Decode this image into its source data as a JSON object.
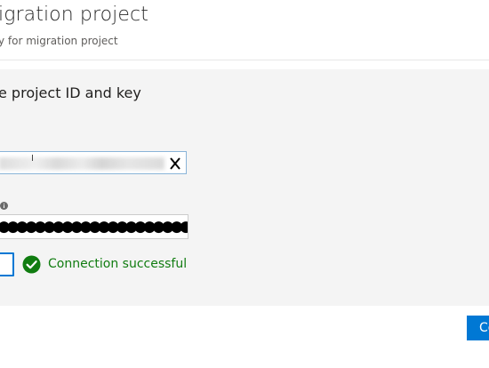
{
  "header": {
    "title": "igration project",
    "subtitle": "y for migration project"
  },
  "section": {
    "heading": "e project ID and key"
  },
  "project_id_field": {
    "clear_icon": "close-icon"
  },
  "key_field": {
    "info_icon": "info-icon",
    "masked_value": "●●●●●●●●●●●●●●●●●●●●●●●●●●●●●●●●●●●●●"
  },
  "connection": {
    "status_icon": "check-circle-icon",
    "status_text": "Connection successful",
    "status_color": "#107c10"
  },
  "footer": {
    "primary_button_label": "Co",
    "accent_color": "#0078d4"
  }
}
